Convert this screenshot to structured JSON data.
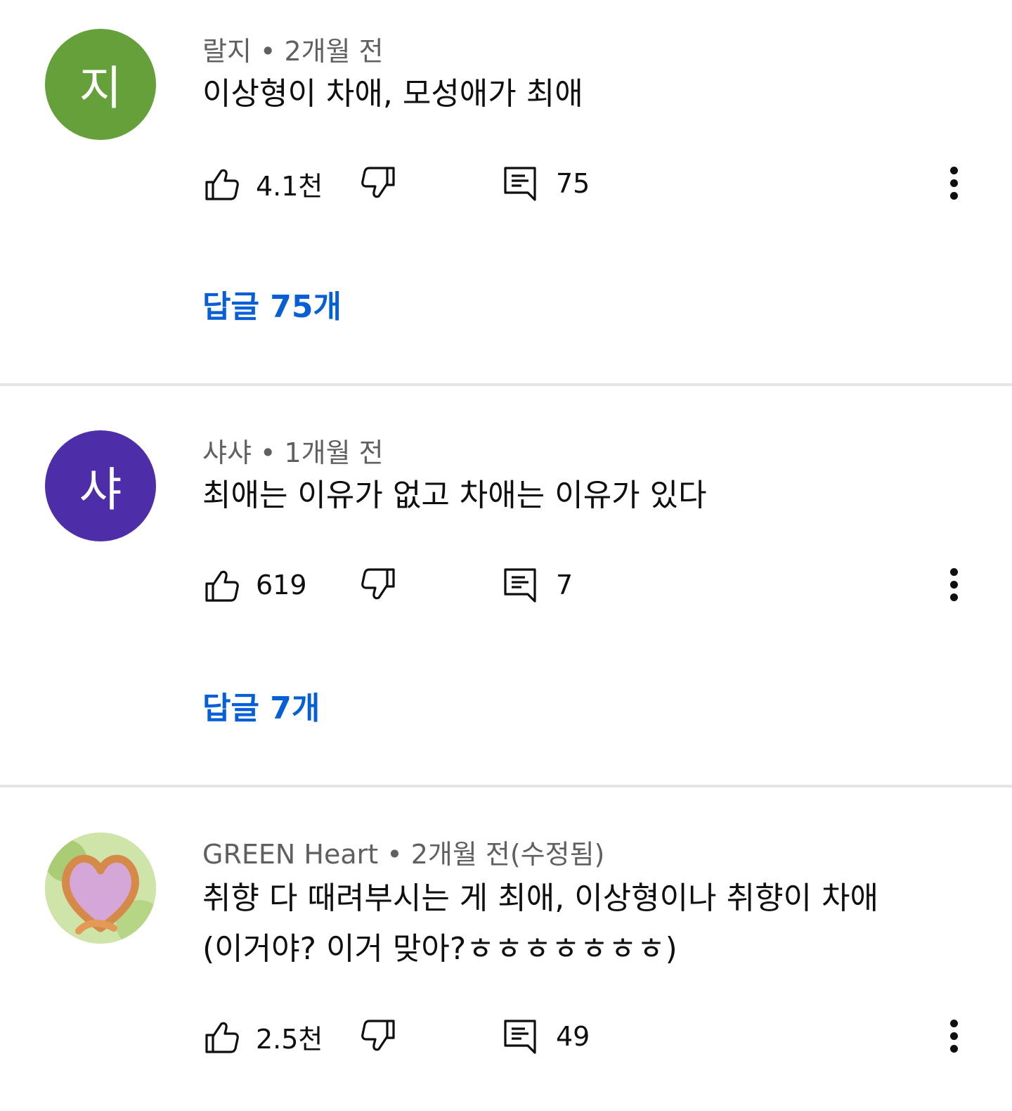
{
  "comments": [
    {
      "author": "랄지",
      "time": "2개월 전",
      "avatar_letter": "지",
      "avatar_color": "#65a03a",
      "text": "이상형이 차애, 모성애가 최애",
      "likes": "4.1천",
      "reply_count": "75",
      "replies_label": "답글 75개"
    },
    {
      "author": "샤샤",
      "time": "1개월 전",
      "avatar_letter": "샤",
      "avatar_color": "#4e2ea8",
      "text": "최애는 이유가 없고 차애는 이유가 있다",
      "likes": "619",
      "reply_count": "7",
      "replies_label": "답글 7개"
    },
    {
      "author": "GREEN Heart",
      "time": "2개월 전(수정됨)",
      "avatar_image": "heart-hands-photo",
      "text": "취향 다 때려부시는 게 최애, 이상형이나 취향이 차애\n(이거야? 이거 맞아?ㅎㅎㅎㅎㅎㅎㅎ)",
      "likes": "2.5천",
      "reply_count": "49"
    }
  ],
  "separator": " • ",
  "icons": [
    "like-icon",
    "dislike-icon",
    "reply-icon",
    "more-options-icon"
  ],
  "colors": {
    "link": "#065fd4",
    "meta": "#606060",
    "divider": "#e5e5e5"
  }
}
